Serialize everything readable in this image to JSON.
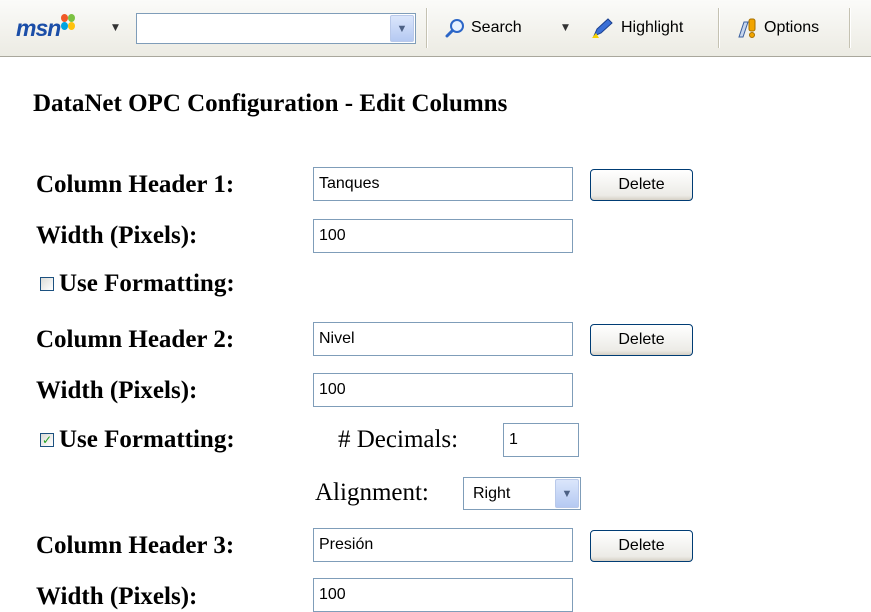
{
  "toolbar": {
    "logo": "msn",
    "search_value": "",
    "search_label": "Search",
    "highlight_label": "Highlight",
    "options_label": "Options"
  },
  "page": {
    "title": "DataNet OPC Configuration - Edit Columns"
  },
  "columns": [
    {
      "header_label": "Column Header 1:",
      "header_value": "Tanques",
      "delete_label": "Delete",
      "width_label": "Width (Pixels):",
      "width_value": "100",
      "formatting_label": "Use Formatting:",
      "formatting_checked": false
    },
    {
      "header_label": "Column Header 2:",
      "header_value": "Nivel",
      "delete_label": "Delete",
      "width_label": "Width (Pixels):",
      "width_value": "100",
      "formatting_label": "Use Formatting:",
      "formatting_checked": true,
      "decimals_label": "# Decimals:",
      "decimals_value": "1",
      "alignment_label": "Alignment:",
      "alignment_value": "Right"
    },
    {
      "header_label": "Column Header 3:",
      "header_value": "Presión",
      "delete_label": "Delete",
      "width_label": "Width (Pixels):",
      "width_value": "100"
    }
  ],
  "colors": {
    "toolbar_bg": "#ecebe3",
    "input_border": "#7f9db9",
    "button_border": "#003c74",
    "check_mark": "#21a121"
  }
}
